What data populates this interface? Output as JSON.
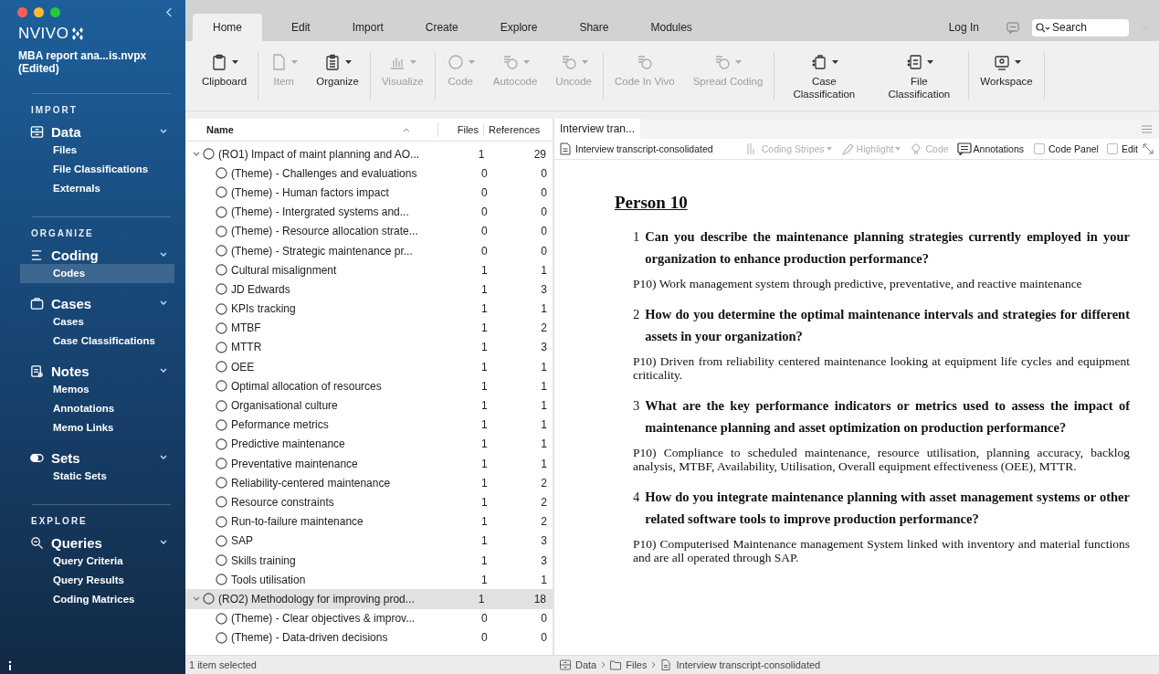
{
  "sidebar": {
    "app_name": "NVIVO",
    "project": "MBA report ana...is.nvpx (Edited)",
    "sections": [
      {
        "heading": "IMPORT",
        "groups": [
          {
            "label": "Data",
            "expanded": true,
            "items": [
              {
                "label": "Files",
                "selected": false
              },
              {
                "label": "File Classifications",
                "selected": false
              },
              {
                "label": "Externals",
                "selected": false
              }
            ]
          }
        ]
      },
      {
        "heading": "ORGANIZE",
        "groups": [
          {
            "label": "Coding",
            "expanded": true,
            "items": [
              {
                "label": "Codes",
                "selected": true
              }
            ]
          },
          {
            "label": "Cases",
            "expanded": true,
            "items": [
              {
                "label": "Cases",
                "selected": false
              },
              {
                "label": "Case Classifications",
                "selected": false
              }
            ]
          },
          {
            "label": "Notes",
            "expanded": true,
            "items": [
              {
                "label": "Memos",
                "selected": false
              },
              {
                "label": "Annotations",
                "selected": false
              },
              {
                "label": "Memo Links",
                "selected": false
              }
            ]
          },
          {
            "label": "Sets",
            "expanded": true,
            "items": [
              {
                "label": "Static Sets",
                "selected": false
              }
            ]
          }
        ]
      },
      {
        "heading": "EXPLORE",
        "groups": [
          {
            "label": "Queries",
            "expanded": true,
            "items": [
              {
                "label": "Query Criteria",
                "selected": false
              },
              {
                "label": "Query Results",
                "selected": false
              },
              {
                "label": "Coding Matrices",
                "selected": false
              }
            ]
          }
        ]
      }
    ]
  },
  "tabs": [
    {
      "label": "Home",
      "selected": true
    },
    {
      "label": "Edit",
      "selected": false
    },
    {
      "label": "Import",
      "selected": false
    },
    {
      "label": "Create",
      "selected": false
    },
    {
      "label": "Explore",
      "selected": false
    },
    {
      "label": "Share",
      "selected": false
    },
    {
      "label": "Modules",
      "selected": false
    }
  ],
  "login": "Log In",
  "search": {
    "placeholder": "Search"
  },
  "ribbon": [
    {
      "label": "Clipboard",
      "disabled": false,
      "dropdown": true,
      "divider_after": true
    },
    {
      "label": "Item",
      "disabled": true,
      "dropdown": true,
      "divider_after": false
    },
    {
      "label": "Organize",
      "disabled": false,
      "dropdown": true,
      "divider_after": true
    },
    {
      "label": "Visualize",
      "disabled": true,
      "dropdown": true,
      "divider_after": true
    },
    {
      "label": "Code",
      "disabled": true,
      "dropdown": true,
      "divider_after": false
    },
    {
      "label": "Autocode",
      "disabled": true,
      "dropdown": true,
      "divider_after": false
    },
    {
      "label": "Uncode",
      "disabled": true,
      "dropdown": true,
      "divider_after": true
    },
    {
      "label": "Code In Vivo",
      "disabled": true,
      "dropdown": false,
      "divider_after": false
    },
    {
      "label": "Spread Coding",
      "disabled": true,
      "dropdown": true,
      "divider_after": true
    },
    {
      "label": "Case Classification",
      "disabled": false,
      "dropdown": true,
      "divider_after": false
    },
    {
      "label": "File Classification",
      "disabled": false,
      "dropdown": true,
      "divider_after": true
    },
    {
      "label": "Workspace",
      "disabled": false,
      "dropdown": true,
      "divider_after": true
    }
  ],
  "code_list": {
    "columns": [
      "Name",
      "Files",
      "References"
    ],
    "codes": [
      {
        "name": "(RO1) Impact of maint planning and AO...",
        "files": "1",
        "references": "29",
        "expanded": true,
        "selected": false,
        "children": [
          {
            "name": "(Theme) - Challenges and evaluations",
            "files": "0",
            "references": "0",
            "selected": false
          },
          {
            "name": "(Theme) - Human factors impact",
            "files": "0",
            "references": "0",
            "selected": false
          },
          {
            "name": "(Theme) - Intergrated systems and...",
            "files": "0",
            "references": "0",
            "selected": false
          },
          {
            "name": "(Theme) - Resource allocation strate...",
            "files": "0",
            "references": "0",
            "selected": false
          },
          {
            "name": "(Theme) - Strategic maintenance pr...",
            "files": "0",
            "references": "0",
            "selected": false
          },
          {
            "name": "Cultural misalignment",
            "files": "1",
            "references": "1",
            "selected": false
          },
          {
            "name": "JD Edwards",
            "files": "1",
            "references": "3",
            "selected": false
          },
          {
            "name": "KPIs tracking",
            "files": "1",
            "references": "1",
            "selected": false
          },
          {
            "name": "MTBF",
            "files": "1",
            "references": "2",
            "selected": false
          },
          {
            "name": "MTTR",
            "files": "1",
            "references": "3",
            "selected": false
          },
          {
            "name": "OEE",
            "files": "1",
            "references": "1",
            "selected": false
          },
          {
            "name": "Optimal allocation of resources",
            "files": "1",
            "references": "1",
            "selected": false
          },
          {
            "name": "Organisational culture",
            "files": "1",
            "references": "1",
            "selected": false
          },
          {
            "name": "Peformance metrics",
            "files": "1",
            "references": "1",
            "selected": false
          },
          {
            "name": "Predictive maintenance",
            "files": "1",
            "references": "1",
            "selected": false
          },
          {
            "name": "Preventative maintenance",
            "files": "1",
            "references": "1",
            "selected": false
          },
          {
            "name": "Reliability-centered maintenance",
            "files": "1",
            "references": "2",
            "selected": false
          },
          {
            "name": "Resource constraints",
            "files": "1",
            "references": "2",
            "selected": false
          },
          {
            "name": "Run-to-failure maintenance",
            "files": "1",
            "references": "2",
            "selected": false
          },
          {
            "name": "SAP",
            "files": "1",
            "references": "3",
            "selected": false
          },
          {
            "name": "Skills training",
            "files": "1",
            "references": "3",
            "selected": false
          },
          {
            "name": "Tools utilisation",
            "files": "1",
            "references": "1",
            "selected": false
          }
        ]
      },
      {
        "name": "(RO2) Methodology for improving prod...",
        "files": "1",
        "references": "18",
        "expanded": true,
        "selected": true,
        "children": [
          {
            "name": "(Theme) - Clear objectives & improv...",
            "files": "0",
            "references": "0",
            "selected": false
          },
          {
            "name": "(Theme) - Data-driven decisions",
            "files": "0",
            "references": "0",
            "selected": false
          }
        ]
      }
    ]
  },
  "document": {
    "tab": "Interview tran...",
    "file_name": "Interview transcript-consolidated",
    "tools": [
      {
        "label": "Coding Stripes",
        "disabled": true,
        "dropdown": true
      },
      {
        "label": "Highlight",
        "disabled": true,
        "dropdown": true
      },
      {
        "label": "Code",
        "disabled": true,
        "dropdown": false
      },
      {
        "label": "Annotations",
        "disabled": false,
        "dropdown": false
      }
    ],
    "checkboxes": [
      {
        "label": "Code Panel",
        "checked": false
      },
      {
        "label": "Edit",
        "checked": false
      }
    ],
    "heading": "Person 10",
    "questions": [
      {
        "number": "1",
        "question": "Can you describe the maintenance planning strategies currently employed in your organization to enhance production performance?",
        "answer": "P10) Work management system through predictive, preventative, and reactive maintenance"
      },
      {
        "number": "2",
        "question": "How do you determine the optimal maintenance intervals and strategies for different assets in your organization?",
        "answer": "P10) Driven from reliability centered maintenance looking at equipment life cycles and equipment criticality."
      },
      {
        "number": "3",
        "question": "What are the key performance indicators or metrics used to assess the impact of maintenance planning and asset optimization on production performance?",
        "answer": "P10) Compliance to scheduled maintenance, resource utilisation, planning accuracy, backlog analysis, MTBF, Availability, Utilisation, Overall equipment effectiveness (OEE), MTTR."
      },
      {
        "number": "4",
        "question": "How do you integrate maintenance planning with asset management systems or other related software tools to improve production performance?",
        "answer": "P10) Computerised Maintenance management System linked with inventory and material functions and are all operated through SAP."
      }
    ]
  },
  "status_bar": {
    "selection": "1 item selected",
    "breadcrumb": [
      "Data",
      "Files",
      "Interview transcript-consolidated"
    ]
  }
}
